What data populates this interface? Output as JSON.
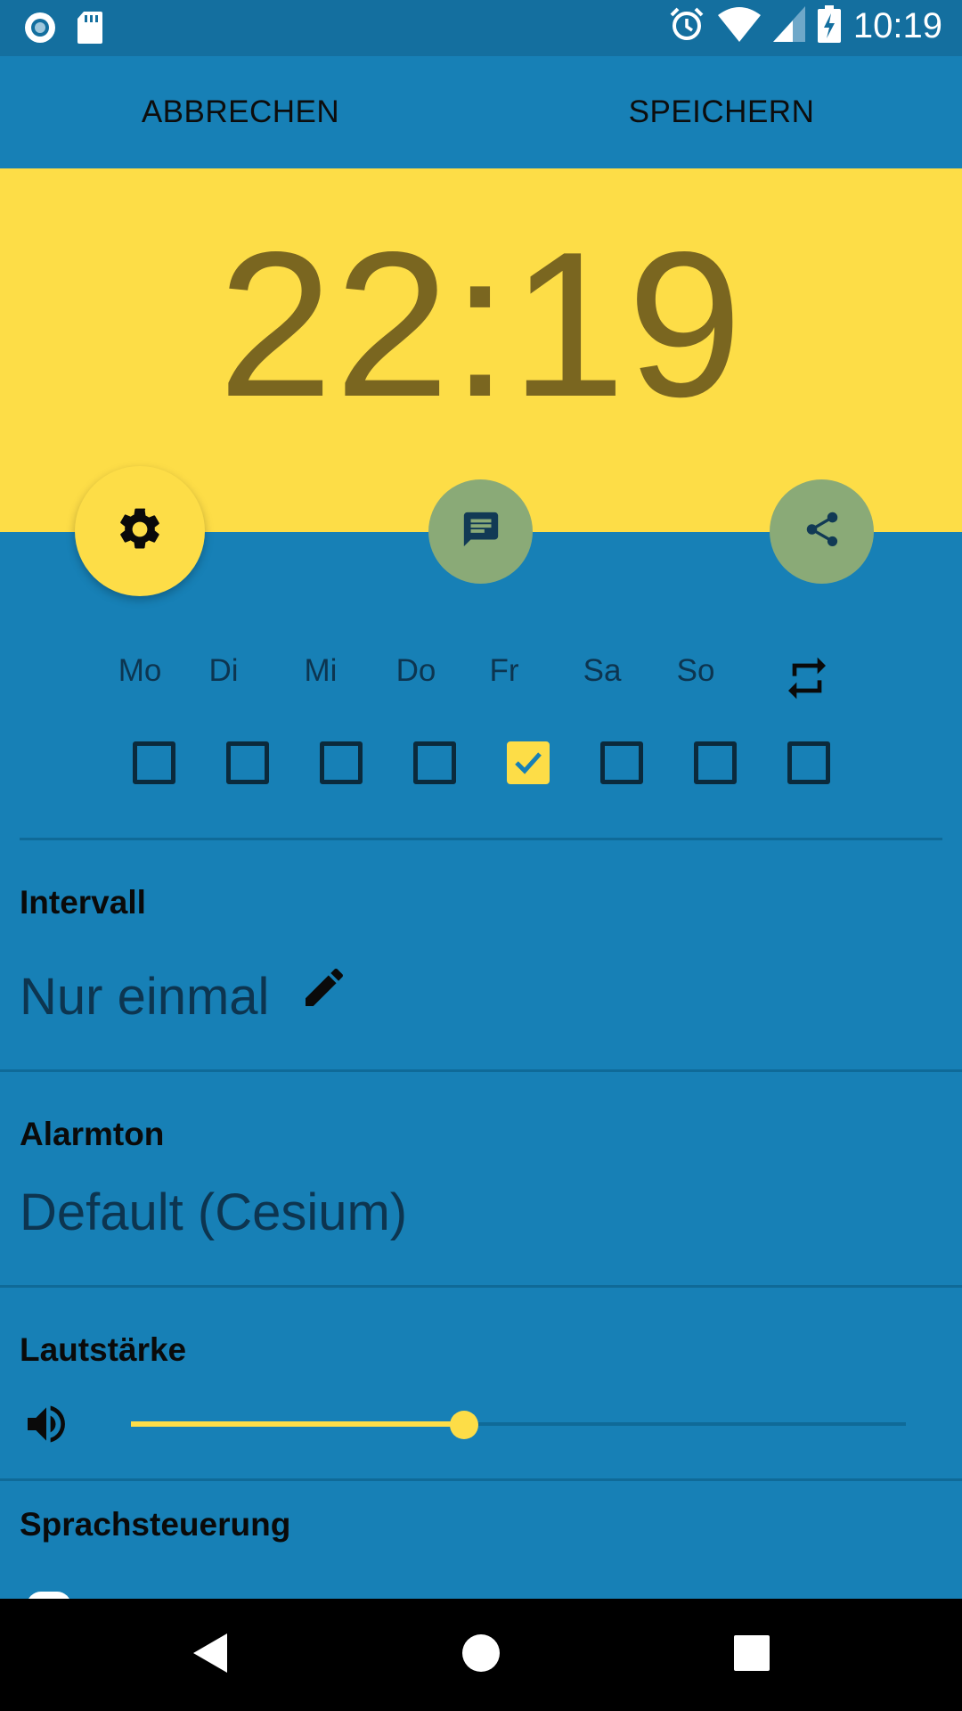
{
  "status_bar": {
    "time": "10:19",
    "left_icons": [
      "record-icon",
      "sd-card-icon"
    ],
    "right_icons": [
      "alarm-icon",
      "wifi-icon",
      "signal-icon",
      "battery-charging-icon"
    ]
  },
  "actionbar": {
    "cancel_label": "ABBRECHEN",
    "save_label": "SPEICHERN"
  },
  "alarm": {
    "time": "22:19"
  },
  "fab_icons": [
    "gear-icon",
    "message-icon",
    "share-icon"
  ],
  "weekdays": {
    "labels": [
      "Mo",
      "Di",
      "Mi",
      "Do",
      "Fr",
      "Sa",
      "So"
    ],
    "checked": [
      false,
      false,
      false,
      false,
      true,
      false,
      false
    ],
    "repeat_checked": false
  },
  "interval": {
    "title": "Intervall",
    "value": "Nur einmal"
  },
  "ringtone": {
    "title": "Alarmton",
    "value": "Default (Cesium)"
  },
  "volume": {
    "title": "Lautstärke",
    "level": 0.43
  },
  "voice": {
    "title": "Sprachsteuerung"
  },
  "colors": {
    "primary": "#1780b6",
    "accent": "#fddd47",
    "status_bar": "#146f9f"
  }
}
